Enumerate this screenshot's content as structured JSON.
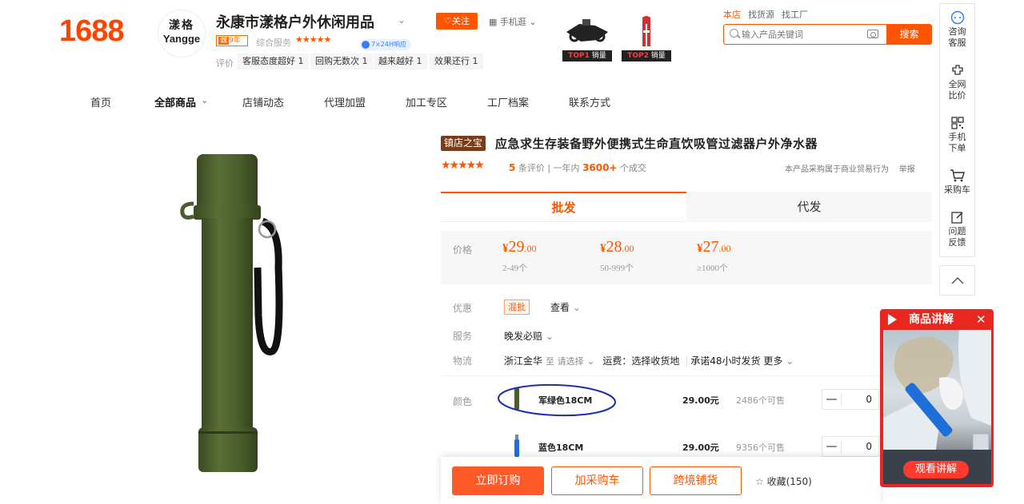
{
  "header": {
    "logo": "1688",
    "shop_avatar_cn": "漾格",
    "shop_avatar_en": "Yangge",
    "shop_name": "永康市漾格户外休闲用品",
    "follow_label": "♡关注",
    "mobile_label": "手机逛",
    "year_badge_prefix": "诚",
    "year_badge_value": "9年",
    "service_label": "综合服务",
    "service_stars": "★★★★★",
    "badge_724": "7×24H响应",
    "eval_label": "评价",
    "eval_tags": [
      "客服态度超好 1",
      "回购无数次 1",
      "越来越好 1",
      "效果还行 1"
    ],
    "top_products": [
      {
        "rank": "TOP1",
        "label": "销量"
      },
      {
        "rank": "TOP2",
        "label": "销量"
      }
    ],
    "search_tabs": [
      "本店",
      "找货源",
      "找工厂"
    ],
    "search_placeholder": "输入产品关键词",
    "search_button": "搜索"
  },
  "sidebar": {
    "items": [
      {
        "label1": "咨询",
        "label2": "客服"
      },
      {
        "label1": "全网",
        "label2": "比价"
      },
      {
        "label1": "手机",
        "label2": "下单"
      },
      {
        "label1": "采购车",
        "label2": ""
      },
      {
        "label1": "问题",
        "label2": "反馈"
      }
    ]
  },
  "nav": {
    "items": [
      "首页",
      "全部商品",
      "店铺动态",
      "代理加盟",
      "加工专区",
      "工厂档案",
      "联系方式"
    ]
  },
  "product": {
    "badge": "镇店之宝",
    "title": "应急求生存装备野外便携式生命直饮吸管过滤器户外净水器",
    "rating_stars": "★★★★★",
    "review_count": "5",
    "review_suffix": "条评价",
    "sales_prefix": "一年内",
    "sales_count": "3600+",
    "sales_suffix": "个成交",
    "report_note": "本产品采购属于商业贸易行为",
    "report_link": "举报",
    "tab_wholesale": "批发",
    "tab_dropship": "代发",
    "price_label": "价格",
    "prices": [
      {
        "symbol": "¥",
        "int": "29",
        "dec": ".00",
        "range": "2-49个"
      },
      {
        "symbol": "¥",
        "int": "28",
        "dec": ".00",
        "range": "50-999个"
      },
      {
        "symbol": "¥",
        "int": "27",
        "dec": ".00",
        "range": "≥1000个"
      }
    ],
    "promo_label": "优惠",
    "promo_tag": "混批",
    "promo_view": "查看",
    "service_label": "服务",
    "service_value": "晚发必赔",
    "logistics_label": "物流",
    "logistics_from": "浙江金华",
    "logistics_to": "至",
    "logistics_select": "请选择",
    "logistics_fee": "运费：选择收货地",
    "logistics_promise": "承诺48小时发货",
    "logistics_more": "更多",
    "color_label": "颜色",
    "skus": [
      {
        "name": "军绿色18CM",
        "price": "29.00元",
        "stock": "2486个可售",
        "qty": "0",
        "minus": "—"
      },
      {
        "name": "蓝色18CM",
        "price": "29.00元",
        "stock": "9356个可售",
        "qty": "0",
        "minus": "—"
      }
    ]
  },
  "actions": {
    "order": "立即订购",
    "cart": "加采购车",
    "dropship": "跨境铺货",
    "favorite": "收藏(150)"
  },
  "live": {
    "title": "商品讲解",
    "close": "✕",
    "watch": "观看讲解"
  },
  "colors": {
    "accent": "#ff5500",
    "live_red": "#e8281e",
    "army_green": "#4a5e2c"
  }
}
